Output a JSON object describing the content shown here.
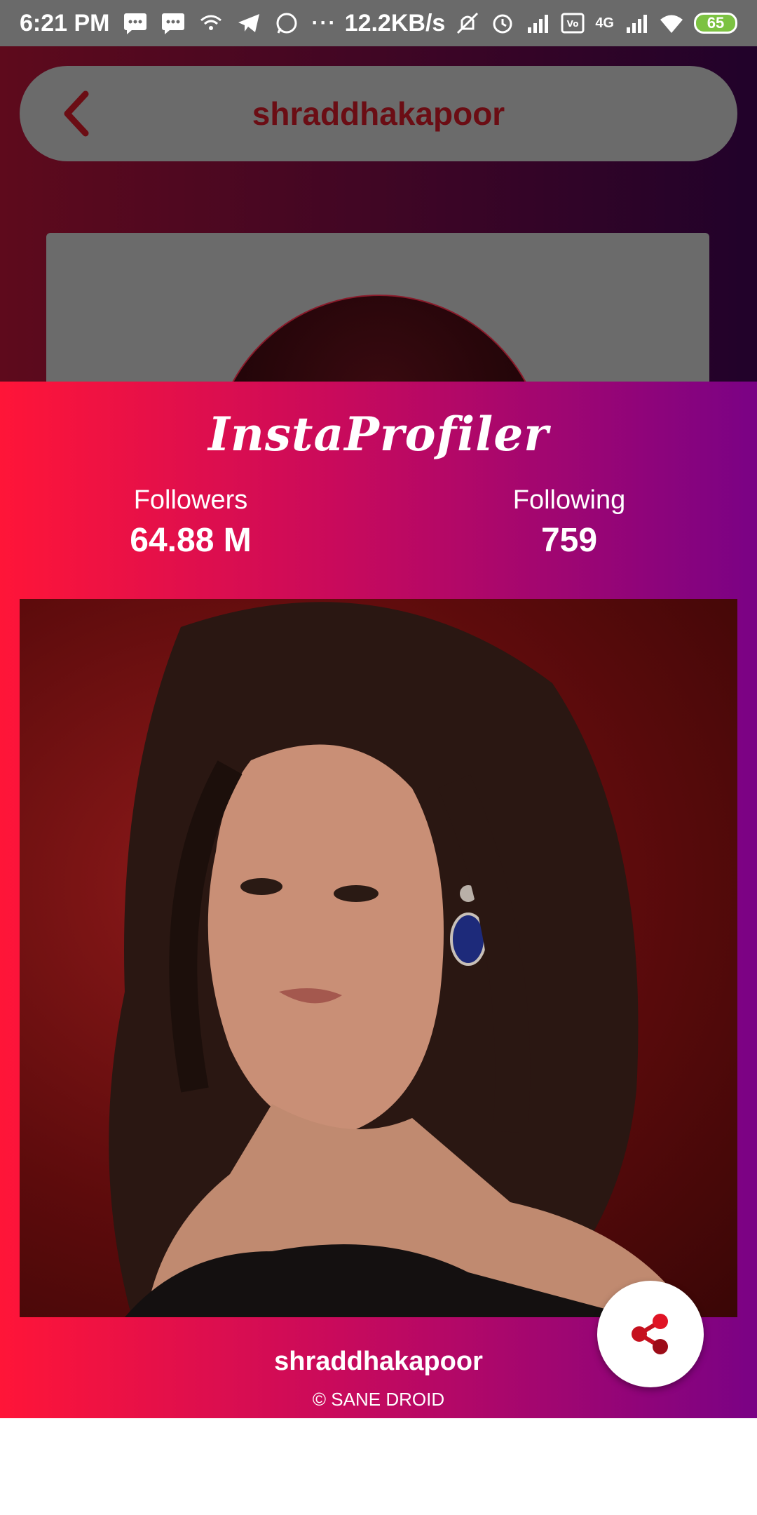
{
  "status_bar": {
    "time": "6:21 PM",
    "net_speed": "12.2KB/s",
    "network_label": "4G",
    "battery": "65",
    "icons": [
      "message-icon",
      "message-icon",
      "wifi-calling-icon",
      "telegram-icon",
      "whatsapp-icon",
      "more-dots-icon",
      "mute-icon",
      "alarm-icon",
      "signal-icon",
      "volte-icon",
      "signal-4g-icon",
      "wifi-icon",
      "battery-icon"
    ]
  },
  "top_bar": {
    "title": "shraddhakapoor",
    "back_icon": "chevron-left-icon"
  },
  "dialog": {
    "brand": "InstaProfiler",
    "followers_label": "Followers",
    "followers_value": "64.88 M",
    "following_label": "Following",
    "following_value": "759",
    "username": "shraddhakapoor",
    "copyright": "© SANE DROID",
    "share_icon": "share-icon"
  },
  "colors": {
    "gradient_start": "#ff1538",
    "gradient_end": "#7a0285",
    "accent": "#d01f2c"
  }
}
